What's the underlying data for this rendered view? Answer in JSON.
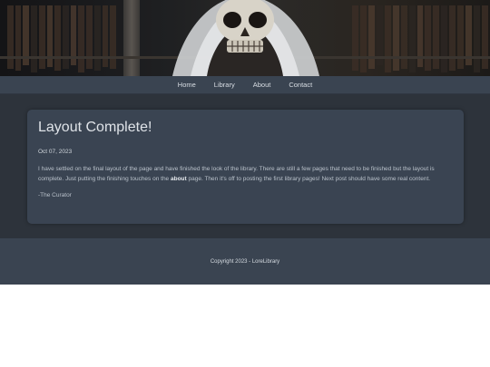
{
  "nav": {
    "items": [
      {
        "label": "Home"
      },
      {
        "label": "Library"
      },
      {
        "label": "About"
      },
      {
        "label": "Contact"
      }
    ]
  },
  "post": {
    "title": "Layout Complete!",
    "date": "Oct 07, 2023",
    "body_before_link": "I have settled on the final layout of the page and have finished the look of the library. There are still a few pages that need to be finished but the layout is complete. Just putting the finishing touches on the ",
    "link_text": "about",
    "body_after_link": " page. Then it's off to posting the first library pages! Next post should have some real content.",
    "signature": "-The Curator"
  },
  "footer": {
    "copyright": "Copyright 2023 - LoreLibrary"
  },
  "colors": {
    "nav_bg": "#3a4451",
    "page_bg": "#2d333b",
    "card_bg": "#3a4452",
    "footer_bg": "#3a4451"
  }
}
